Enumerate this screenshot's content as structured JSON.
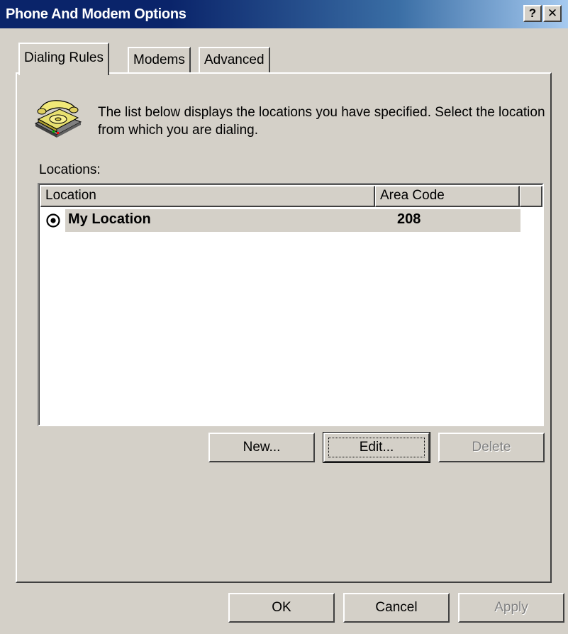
{
  "window": {
    "title": "Phone And Modem Options",
    "help_button": "?",
    "close_button": "✕"
  },
  "tabs": [
    {
      "label": "Dialing Rules",
      "active": true
    },
    {
      "label": "Modems",
      "active": false
    },
    {
      "label": "Advanced",
      "active": false
    }
  ],
  "panel": {
    "icon": "telephone-icon",
    "description": "The list below displays the locations you have specified. Select the location from which you are dialing.",
    "locations_label": "Locations:"
  },
  "listview": {
    "columns": [
      "Location",
      "Area Code"
    ],
    "rows": [
      {
        "location": "My Location",
        "area_code": "208",
        "selected": true,
        "icon": "radio-selected-icon"
      }
    ]
  },
  "list_buttons": {
    "new_label": "New...",
    "edit_label": "Edit...",
    "delete_label": "Delete"
  },
  "dialog_buttons": {
    "ok_label": "OK",
    "cancel_label": "Cancel",
    "apply_label": "Apply"
  },
  "colors": {
    "titlebar_start": "#0a246a",
    "titlebar_end": "#a6caf0",
    "face": "#d4d0c8"
  }
}
